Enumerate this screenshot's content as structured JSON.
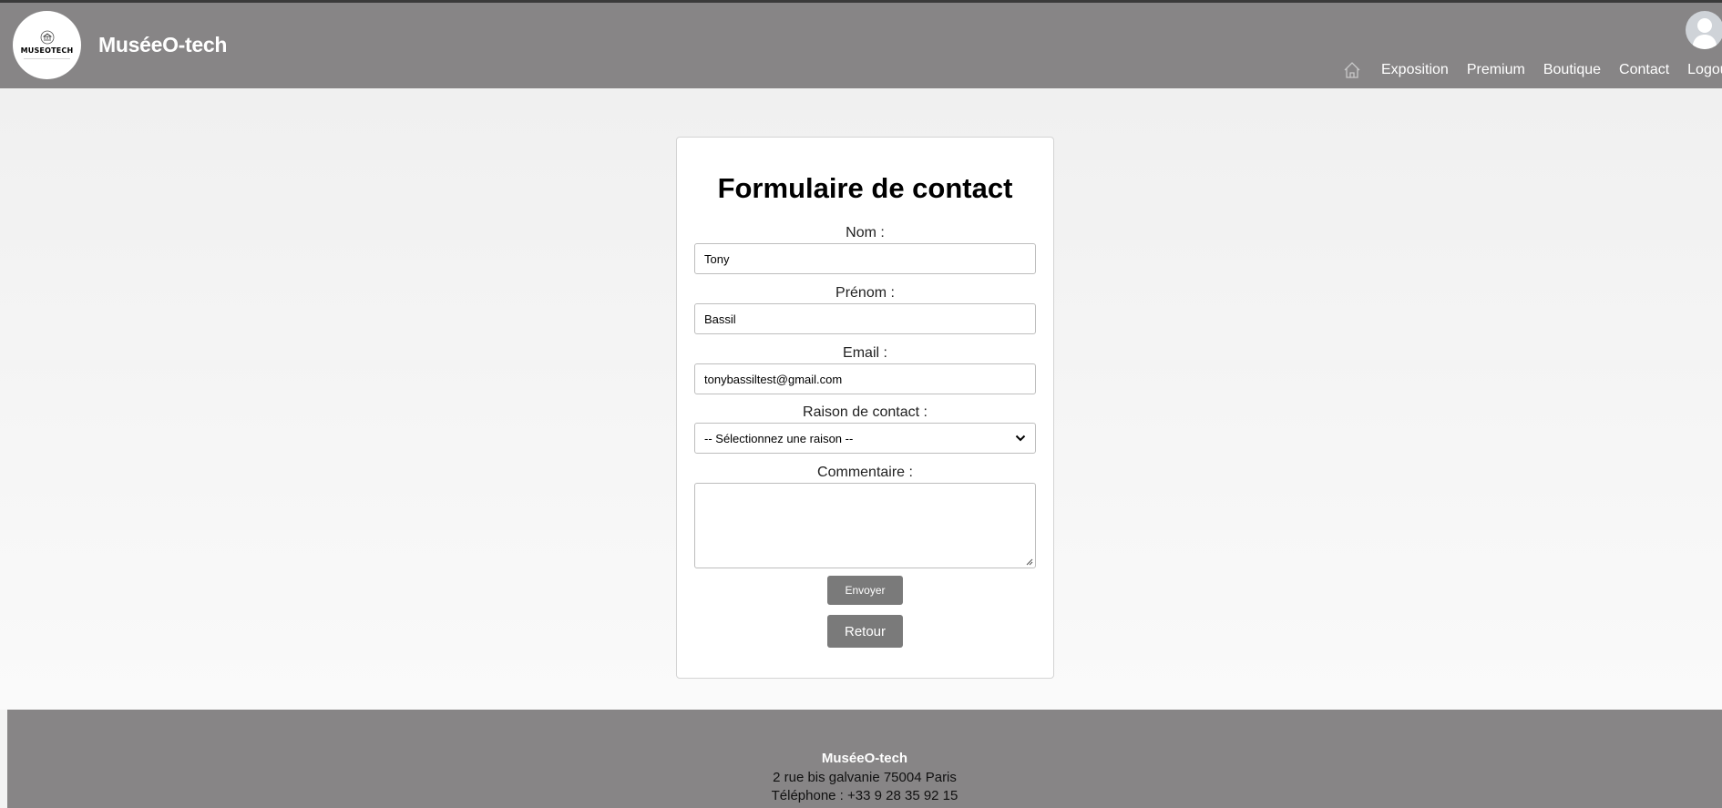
{
  "header": {
    "brand": "MuséeO-tech",
    "logo_text": "MUSEOTECH",
    "nav": [
      {
        "label": "Exposition"
      },
      {
        "label": "Premium"
      },
      {
        "label": "Boutique"
      },
      {
        "label": "Contact"
      },
      {
        "label": "Logout"
      }
    ],
    "home_icon": "home-icon",
    "avatar_icon": "user-avatar-icon"
  },
  "form": {
    "title": "Formulaire de contact",
    "nom_label": "Nom :",
    "nom_value": "Tony",
    "prenom_label": "Prénom :",
    "prenom_value": "Bassil",
    "email_label": "Email :",
    "email_value": "tonybassiltest@gmail.com",
    "raison_label": "Raison de contact :",
    "raison_selected": "-- Sélectionnez une raison --",
    "commentaire_label": "Commentaire :",
    "commentaire_value": "",
    "send_label": "Envoyer",
    "back_label": "Retour"
  },
  "footer": {
    "name": "MuséeO-tech",
    "address": "2 rue bis galvanie 75004 Paris",
    "phone": "Téléphone : +33 9 28 35 92 15"
  },
  "colors": {
    "header_bg": "#878586",
    "button_bg": "#7a7a7a",
    "page_bg": "#f3f3f3"
  }
}
